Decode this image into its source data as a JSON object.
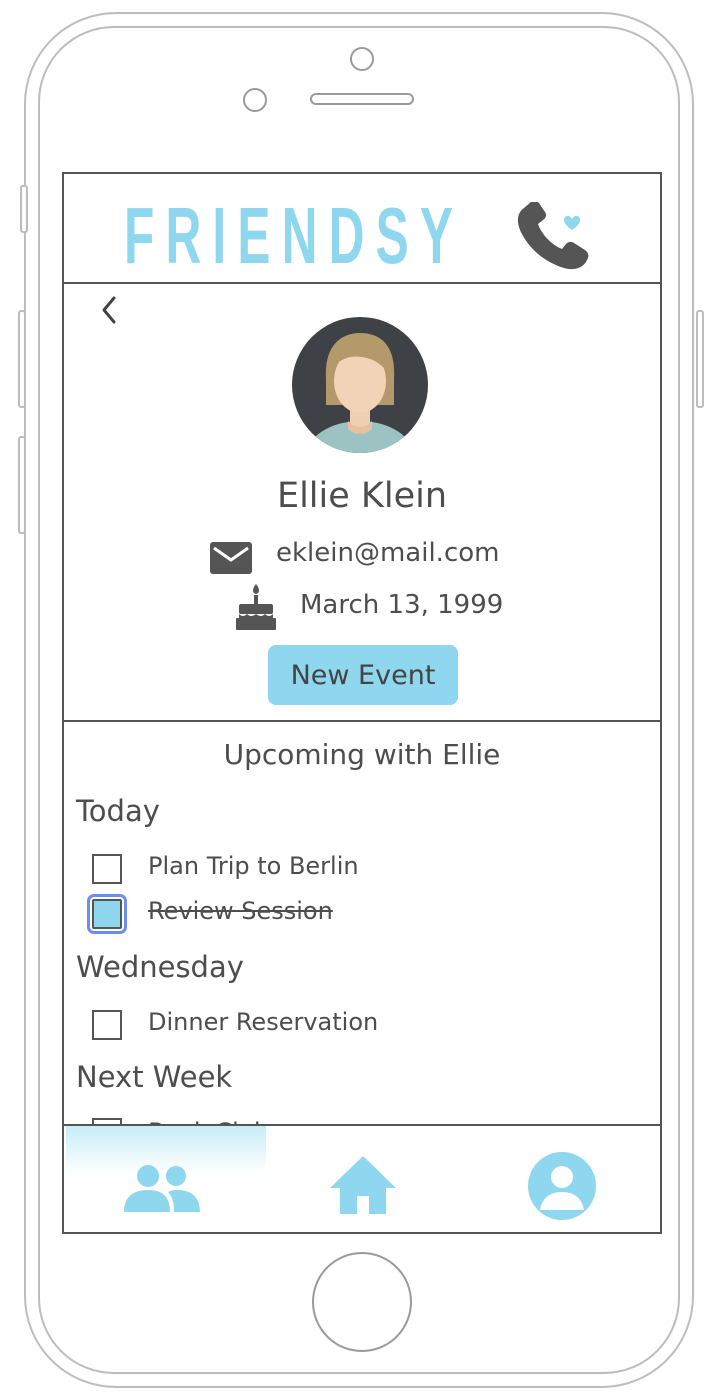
{
  "app": {
    "logo_text": "FRIENDSY",
    "accent_color": "#8fd7ee",
    "text_color": "#4d4d4d"
  },
  "profile": {
    "name": "Ellie Klein",
    "email": "eklein@mail.com",
    "birthday": "March 13, 1999",
    "new_event_label": "New Event"
  },
  "upcoming": {
    "title": "Upcoming with Ellie",
    "groups": [
      {
        "label": "Today",
        "tasks": [
          {
            "label": "Plan Trip to Berlin",
            "checked": false
          },
          {
            "label": "Review Session",
            "checked": true
          }
        ]
      },
      {
        "label": "Wednesday",
        "tasks": [
          {
            "label": "Dinner Reservation",
            "checked": false
          }
        ]
      },
      {
        "label": "Next Week",
        "tasks": [
          {
            "label": "Book Club",
            "checked": false
          }
        ]
      }
    ]
  },
  "icons": {
    "back": "chevron-left-icon",
    "email": "envelope-icon",
    "birthday": "birthday-cake-icon",
    "logo": "phone-heart-icon",
    "tabs": [
      "friends-icon",
      "home-icon",
      "profile-icon"
    ]
  }
}
